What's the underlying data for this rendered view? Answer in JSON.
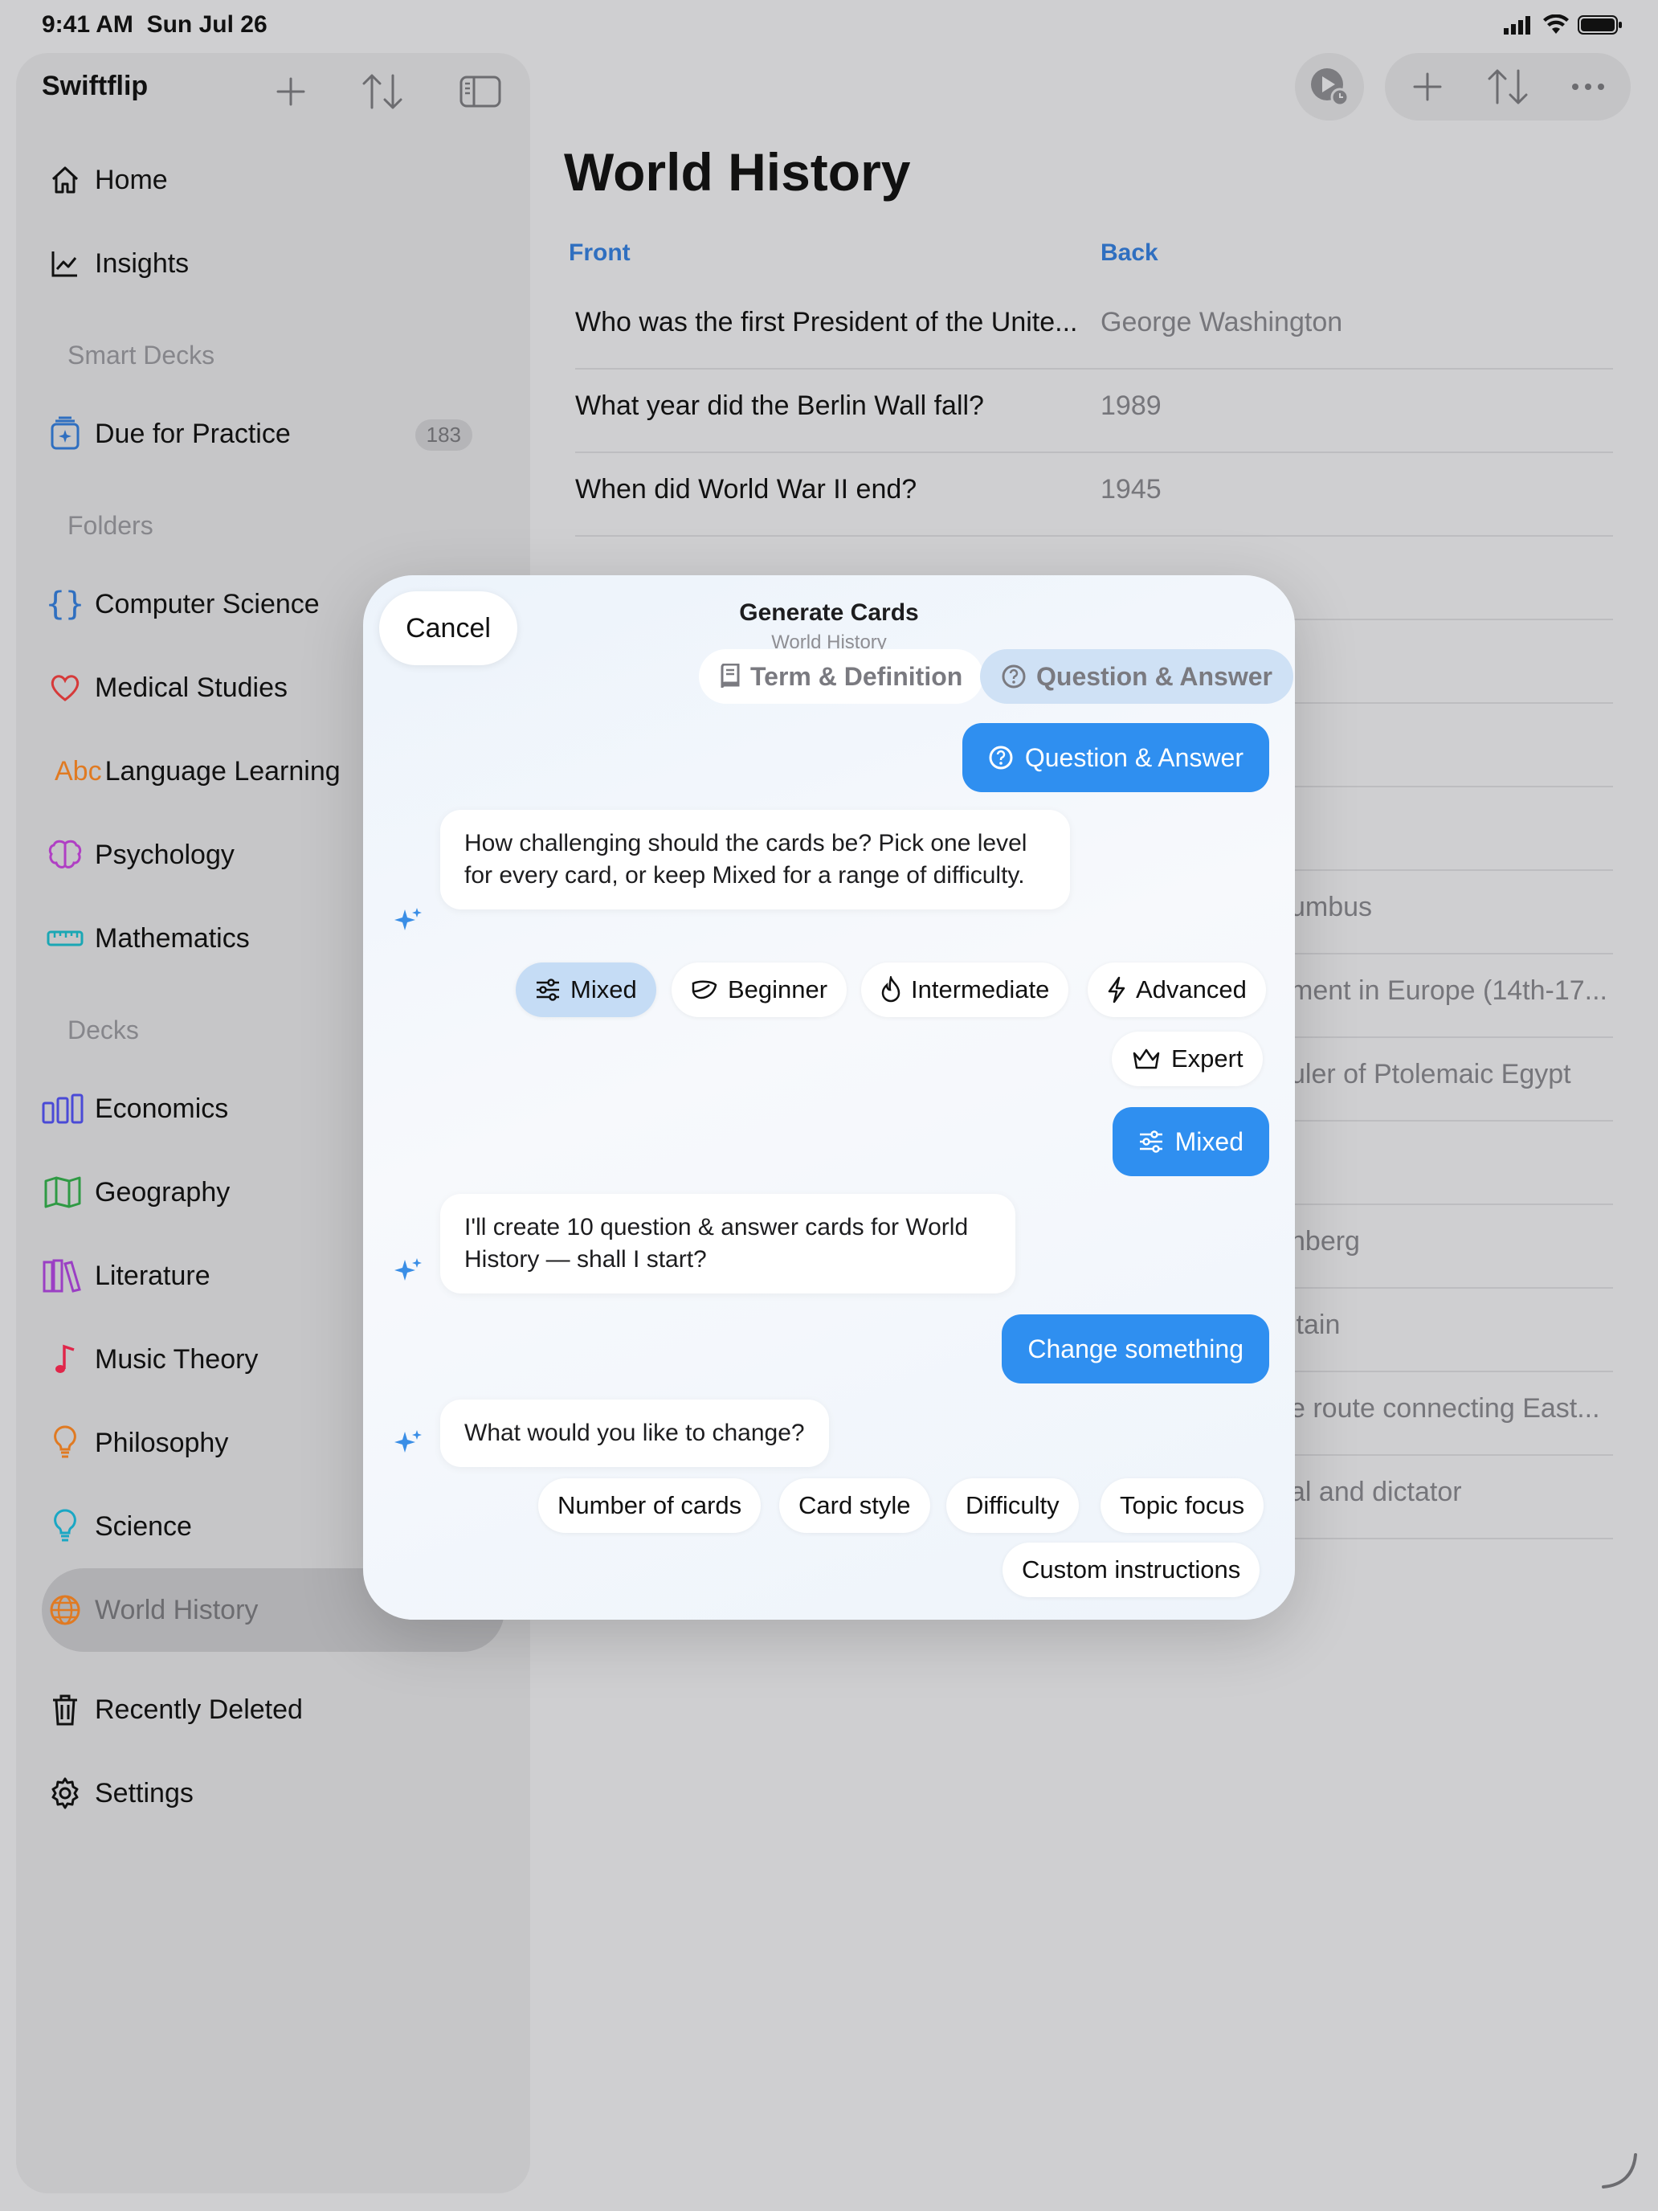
{
  "status": {
    "time": "9:41 AM",
    "date": "Sun Jul 26"
  },
  "sidebar": {
    "app_title": "Swiftflip",
    "nav": [
      {
        "label": "Home",
        "icon": "house-icon"
      },
      {
        "label": "Insights",
        "icon": "chart-line-icon"
      }
    ],
    "smart_decks_header": "Smart Decks",
    "smart_decks": [
      {
        "label": "Due for Practice",
        "icon": "sparkle-deck-icon",
        "badge": "183"
      }
    ],
    "folders_header": "Folders",
    "folders": [
      {
        "label": "Computer Science",
        "icon": "braces-icon"
      },
      {
        "label": "Medical Studies",
        "icon": "heart-icon"
      },
      {
        "label": "Language Learning",
        "icon": "abc-icon",
        "icon_text": "Abc"
      },
      {
        "label": "Psychology",
        "icon": "brain-icon"
      },
      {
        "label": "Mathematics",
        "icon": "ruler-icon"
      }
    ],
    "decks_header": "Decks",
    "decks": [
      {
        "label": "Economics",
        "icon": "bar-chart-icon"
      },
      {
        "label": "Geography",
        "icon": "map-icon"
      },
      {
        "label": "Literature",
        "icon": "books-icon"
      },
      {
        "label": "Music Theory",
        "icon": "music-note-icon"
      },
      {
        "label": "Philosophy",
        "icon": "lightbulb-icon"
      },
      {
        "label": "Science",
        "icon": "lightbulb-icon"
      },
      {
        "label": "World History",
        "icon": "globe-icon"
      }
    ],
    "bottom": [
      {
        "label": "Recently Deleted",
        "icon": "trash-icon"
      },
      {
        "label": "Settings",
        "icon": "gear-icon"
      }
    ]
  },
  "main": {
    "title": "World History",
    "col_front": "Front",
    "col_back": "Back",
    "rows": [
      {
        "front": "Who was the first President of the Unite...",
        "back": "George Washington"
      },
      {
        "front": "What year did the Berlin Wall fall?",
        "back": "1989"
      },
      {
        "front": "When did World War II end?",
        "back": "1945"
      }
    ],
    "partial_back": [
      "umbus",
      "ment in Europe (14th-17...",
      "uler of Ptolemaic Egypt",
      "nberg",
      "itain",
      "e route connecting East...",
      "al and dictator"
    ]
  },
  "modal": {
    "cancel": "Cancel",
    "title": "Generate Cards",
    "subtitle": "World History",
    "segments": [
      {
        "label": "Term & Definition",
        "icon": "book-icon"
      },
      {
        "label": "Question & Answer",
        "icon": "question-circle-icon"
      }
    ],
    "user_reply_1": "Question & Answer",
    "ai_msg_1": "How challenging should the cards be? Pick one level for every card, or keep Mixed for a range of difficulty.",
    "difficulty_options": [
      {
        "label": "Mixed",
        "icon": "sliders-icon",
        "selected": true
      },
      {
        "label": "Beginner",
        "icon": "leaf-icon"
      },
      {
        "label": "Intermediate",
        "icon": "flame-icon"
      },
      {
        "label": "Advanced",
        "icon": "bolt-icon"
      },
      {
        "label": "Expert",
        "icon": "crown-icon"
      }
    ],
    "user_reply_2": "Mixed",
    "ai_msg_2": "I'll create 10 question & answer cards for World History — shall I start?",
    "user_reply_3": "Change something",
    "ai_msg_3": "What would you like to change?",
    "change_options": [
      "Number of cards",
      "Card style",
      "Difficulty",
      "Topic focus",
      "Custom instructions"
    ]
  },
  "colors": {
    "accent": "#2f8ff0",
    "link": "#2f6fc0"
  }
}
